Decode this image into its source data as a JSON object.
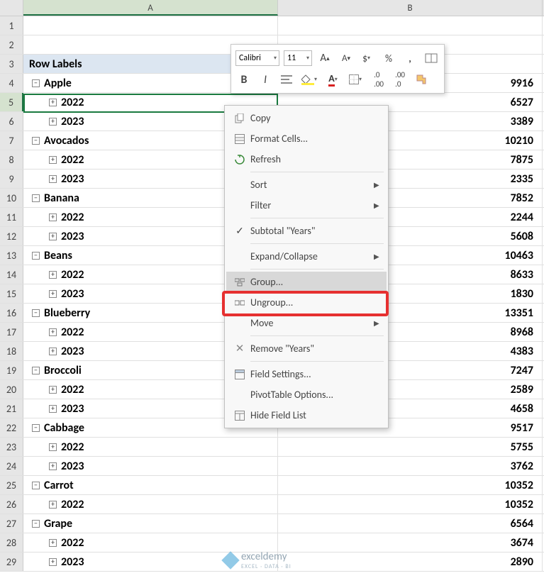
{
  "columns": {
    "a": "A",
    "b": "B"
  },
  "header_cell": "Row Labels",
  "rows": [
    {
      "n": "1",
      "a": "",
      "b": "",
      "lvl": null
    },
    {
      "n": "2",
      "a": "",
      "b": "",
      "lvl": null
    },
    {
      "n": "3",
      "a": "Row Labels",
      "b": "",
      "lvl": "hdr"
    },
    {
      "n": "4",
      "a": "Apple",
      "b": "9916",
      "lvl": 0,
      "exp": "-"
    },
    {
      "n": "5",
      "a": "2022",
      "b": "6527",
      "lvl": 1,
      "exp": "+",
      "active": true
    },
    {
      "n": "6",
      "a": "2023",
      "b": "3389",
      "lvl": 1,
      "exp": "+"
    },
    {
      "n": "7",
      "a": "Avocados",
      "b": "10210",
      "lvl": 0,
      "exp": "-"
    },
    {
      "n": "8",
      "a": "2022",
      "b": "7875",
      "lvl": 1,
      "exp": "+"
    },
    {
      "n": "9",
      "a": "2023",
      "b": "2335",
      "lvl": 1,
      "exp": "+"
    },
    {
      "n": "10",
      "a": "Banana",
      "b": "7852",
      "lvl": 0,
      "exp": "-"
    },
    {
      "n": "11",
      "a": "2022",
      "b": "2244",
      "lvl": 1,
      "exp": "+"
    },
    {
      "n": "12",
      "a": "2023",
      "b": "5608",
      "lvl": 1,
      "exp": "+"
    },
    {
      "n": "13",
      "a": "Beans",
      "b": "10463",
      "lvl": 0,
      "exp": "-"
    },
    {
      "n": "14",
      "a": "2022",
      "b": "8633",
      "lvl": 1,
      "exp": "+"
    },
    {
      "n": "15",
      "a": "2023",
      "b": "1830",
      "lvl": 1,
      "exp": "+"
    },
    {
      "n": "16",
      "a": "Blueberry",
      "b": "13351",
      "lvl": 0,
      "exp": "-"
    },
    {
      "n": "17",
      "a": "2022",
      "b": "8968",
      "lvl": 1,
      "exp": "+"
    },
    {
      "n": "18",
      "a": "2023",
      "b": "4383",
      "lvl": 1,
      "exp": "+"
    },
    {
      "n": "19",
      "a": "Broccoli",
      "b": "7247",
      "lvl": 0,
      "exp": "-"
    },
    {
      "n": "20",
      "a": "2022",
      "b": "2589",
      "lvl": 1,
      "exp": "+"
    },
    {
      "n": "21",
      "a": "2023",
      "b": "4658",
      "lvl": 1,
      "exp": "+"
    },
    {
      "n": "22",
      "a": "Cabbage",
      "b": "9517",
      "lvl": 0,
      "exp": "-"
    },
    {
      "n": "23",
      "a": "2022",
      "b": "5755",
      "lvl": 1,
      "exp": "+"
    },
    {
      "n": "24",
      "a": "2023",
      "b": "3762",
      "lvl": 1,
      "exp": "+"
    },
    {
      "n": "25",
      "a": "Carrot",
      "b": "10352",
      "lvl": 0,
      "exp": "-"
    },
    {
      "n": "26",
      "a": "2022",
      "b": "10352",
      "lvl": 1,
      "exp": "+"
    },
    {
      "n": "27",
      "a": "Grape",
      "b": "6564",
      "lvl": 0,
      "exp": "-"
    },
    {
      "n": "28",
      "a": "2022",
      "b": "3674",
      "lvl": 1,
      "exp": "+"
    },
    {
      "n": "29",
      "a": "2023",
      "b": "2890",
      "lvl": 1,
      "exp": "+"
    }
  ],
  "mini": {
    "font": "Calibri",
    "size": "11"
  },
  "ctx": {
    "copy": "Copy",
    "format_cells": "Format Cells...",
    "refresh": "Refresh",
    "sort": "Sort",
    "filter": "Filter",
    "subtotal": "Subtotal \"Years\"",
    "expand": "Expand/Collapse",
    "group": "Group...",
    "ungroup": "Ungroup...",
    "move": "Move",
    "remove": "Remove \"Years\"",
    "field_settings": "Field Settings...",
    "pt_options": "PivotTable Options...",
    "hide_field": "Hide Field List"
  },
  "watermark": {
    "name": "exceldemy",
    "sub": "EXCEL · DATA · BI"
  }
}
